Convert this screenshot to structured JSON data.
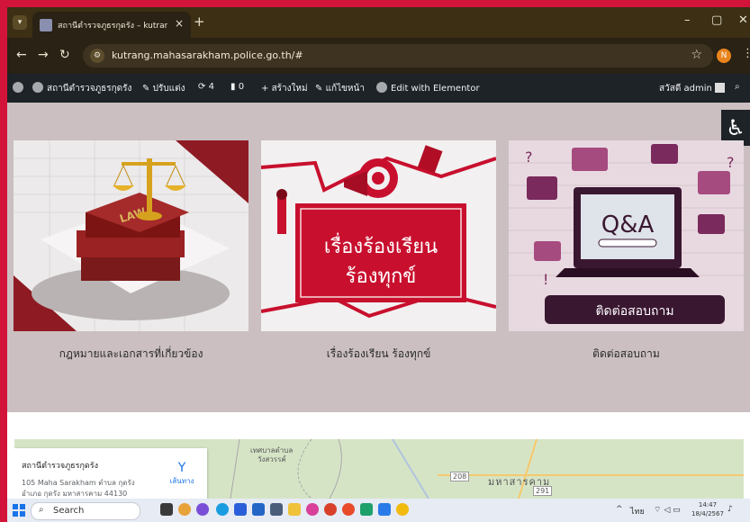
{
  "browser": {
    "tab_title": "สถานีตำรวจภูธรกุดรัง – kutrang Police",
    "tab_close": "×",
    "new_tab": "+",
    "url": "kutrang.mahasarakham.police.go.th/#",
    "profile_initial": "N"
  },
  "wp_admin_bar": {
    "site_name": "สถานีตำรวจภูธรกุดรัง",
    "customize": "ปรับแต่ง",
    "updates_count": "4",
    "comments_count": "0",
    "new": "สร้างใหม่",
    "edit_page": "แก้ไขหน้า",
    "elementor": "Edit with Elementor",
    "greeting": "สวัสดี admin"
  },
  "cards": [
    {
      "caption": "กฎหมายและเอกสารที่เกี่ยวข้อง",
      "image_text": "LAW"
    },
    {
      "caption": "เรื่องร้องเรียน ร้องทุกข์",
      "image_line1": "เรื่องร้องเรียน",
      "image_line2": "ร้องทุกข์"
    },
    {
      "caption": "ติดต่อสอบถาม",
      "image_text": "Q&A",
      "image_label": "ติดต่อสอบถาม"
    }
  ],
  "map": {
    "place_name": "สถานีตำรวจภูธรกุดรัง",
    "address_line1": "105 Maha Sarakham ตำบล กุดรัง",
    "address_line2": "อำเภอ กุดรัง มหาสารคาม 44130",
    "directions": "เส้นทาง",
    "label_district": "เทศบาลตำบล",
    "label_district2": "วังสวรรค์",
    "label_province": "มหาสารคาม",
    "road1": "208",
    "road2": "291"
  },
  "taskbar": {
    "search_label": "Search",
    "lang": "ไทย",
    "time": "14:47",
    "date": "18/4/2567"
  },
  "colors": {
    "outer_border": "#d3143a",
    "chrome_dark": "#3c2f14",
    "wp_bar": "#1d2327",
    "page_bg": "#cbbfc1",
    "complaint_red": "#c8102e"
  }
}
